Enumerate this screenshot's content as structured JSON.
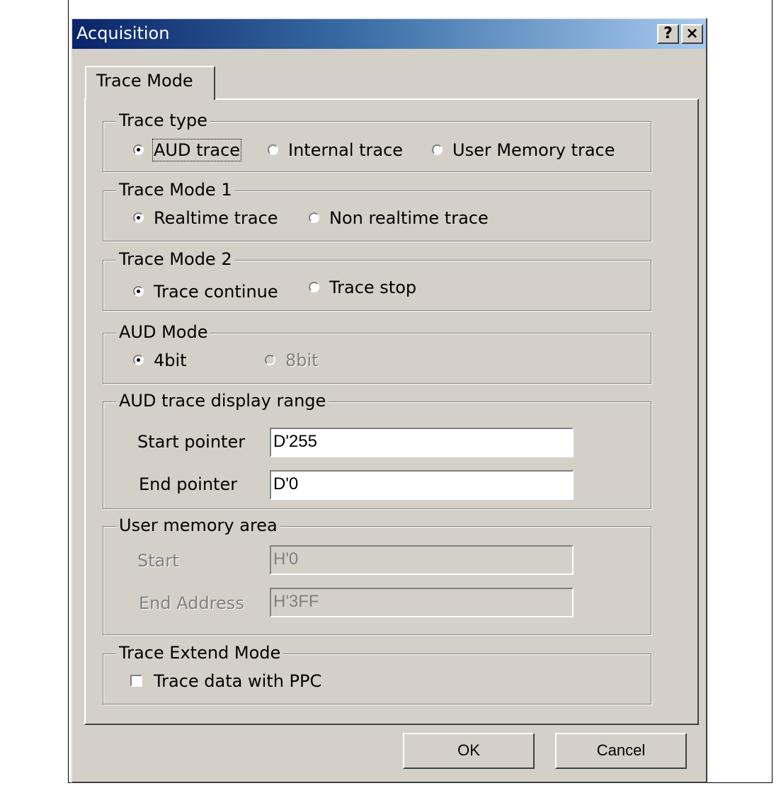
{
  "window": {
    "title": "Acquisition",
    "help_glyph": "?",
    "close_glyph": "×"
  },
  "tabs": [
    {
      "label": "Trace Mode",
      "active": true
    }
  ],
  "trace_type": {
    "legend": "Trace type",
    "options": [
      {
        "label": "AUD trace",
        "selected": true
      },
      {
        "label": "Internal trace",
        "selected": false
      },
      {
        "label": "User Memory trace",
        "selected": false
      }
    ]
  },
  "trace_mode_1": {
    "legend": "Trace Mode 1",
    "options": [
      {
        "label": "Realtime trace",
        "selected": true
      },
      {
        "label": "Non realtime trace",
        "selected": false
      }
    ]
  },
  "trace_mode_2": {
    "legend": "Trace Mode 2",
    "options": [
      {
        "label": "Trace continue",
        "selected": true
      },
      {
        "label": "Trace stop",
        "selected": false
      }
    ]
  },
  "aud_mode": {
    "legend": "AUD Mode",
    "options": [
      {
        "label": "4bit",
        "selected": true,
        "enabled": true
      },
      {
        "label": "8bit",
        "selected": false,
        "enabled": false
      }
    ]
  },
  "aud_range": {
    "legend": "AUD trace display range",
    "start_label": "Start pointer",
    "start_value": "D'255",
    "end_label": "End pointer",
    "end_value": "D'0"
  },
  "user_memory": {
    "legend": "User memory area",
    "enabled": false,
    "start_label": "Start",
    "start_value": "H'0",
    "end_label": "End Address",
    "end_value": "H'3FF"
  },
  "trace_extend": {
    "legend": "Trace Extend Mode",
    "checkbox_label": "Trace data with PPC",
    "checked": false
  },
  "buttons": {
    "ok": "OK",
    "cancel": "Cancel"
  }
}
